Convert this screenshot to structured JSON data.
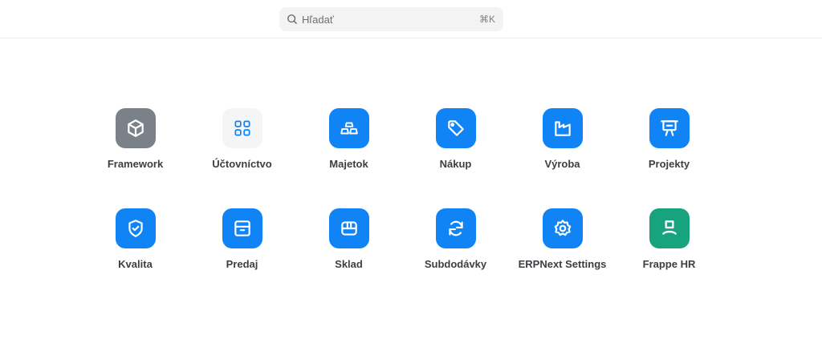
{
  "search": {
    "placeholder": "Hľadať",
    "shortcut": "⌘K",
    "icon": "search-icon"
  },
  "colors": {
    "blue": "#1184f5",
    "gray": "#7b8189",
    "light": "#f4f5f6",
    "green": "#16a37d"
  },
  "apps": [
    {
      "label": "Framework",
      "icon": "cube-icon",
      "color": "#7b8189"
    },
    {
      "label": "Účtovníctvo",
      "icon": "accounting-grid-icon",
      "color": "#f4f5f6"
    },
    {
      "label": "Majetok",
      "icon": "gold-bars-icon",
      "color": "#1184f5"
    },
    {
      "label": "Nákup",
      "icon": "tag-icon",
      "color": "#1184f5"
    },
    {
      "label": "Výroba",
      "icon": "factory-icon",
      "color": "#1184f5"
    },
    {
      "label": "Projekty",
      "icon": "presentation-board-icon",
      "color": "#1184f5"
    },
    {
      "label": "Kvalita",
      "icon": "shield-check-icon",
      "color": "#1184f5"
    },
    {
      "label": "Predaj",
      "icon": "archive-box-icon",
      "color": "#1184f5"
    },
    {
      "label": "Sklad",
      "icon": "warehouse-box-icon",
      "color": "#1184f5"
    },
    {
      "label": "Subdodávky",
      "icon": "refresh-icon",
      "color": "#1184f5"
    },
    {
      "label": "ERPNext Settings",
      "icon": "gear-icon",
      "color": "#1184f5"
    },
    {
      "label": "Frappe HR",
      "icon": "frappe-hr-icon",
      "color": "#16a37d"
    }
  ]
}
